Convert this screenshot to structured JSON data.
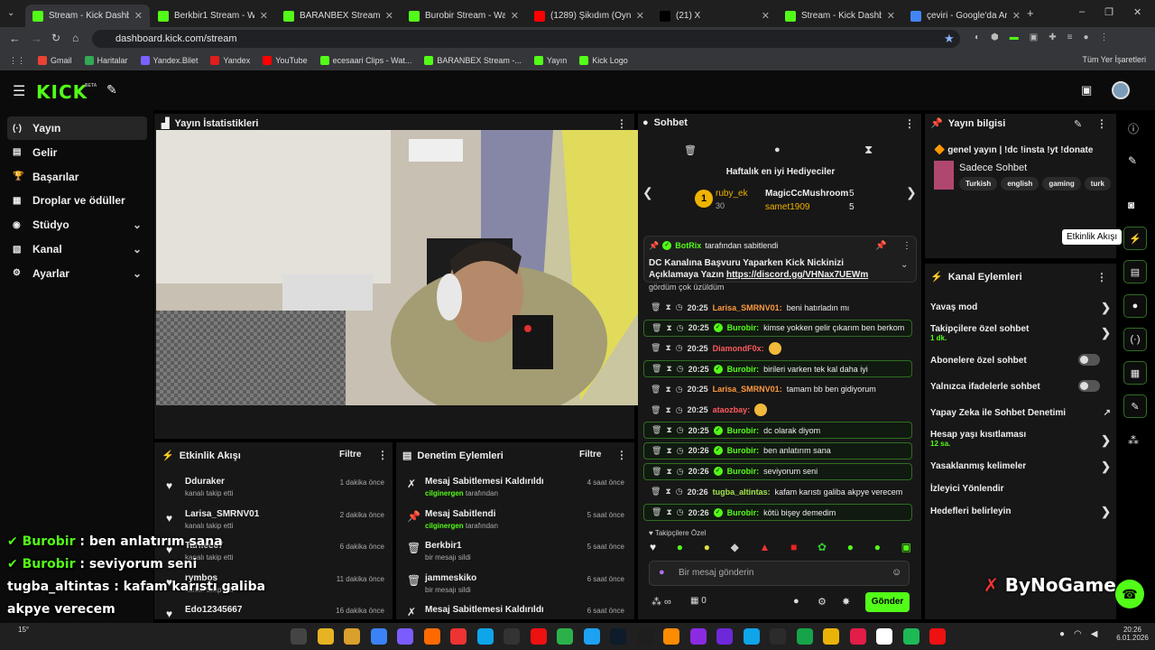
{
  "browser": {
    "tabs": [
      {
        "title": "Stream - Kick Dashboard",
        "active": true,
        "color": "#53fc18"
      },
      {
        "title": "Berkbir1 Stream - Watch L",
        "color": "#53fc18"
      },
      {
        "title": "BARANBEX Stream - Watc",
        "color": "#53fc18"
      },
      {
        "title": "Burobir Stream - Watch Li",
        "color": "#53fc18"
      },
      {
        "title": "(1289) Şikıdım (Oynan",
        "color": "#ff0000"
      },
      {
        "title": "(21) X",
        "color": "#000000"
      },
      {
        "title": "Stream - Kick Dashboard",
        "color": "#53fc18"
      },
      {
        "title": "çeviri - Google'da Ara",
        "color": "#4285f4"
      }
    ],
    "url": "dashboard.kick.com/stream",
    "bookmarks": [
      "Gmail",
      "Haritalar",
      "Yandex.Bilet",
      "Yandex",
      "YouTube",
      "ecesaari Clips - Wat...",
      "BARANBEX Stream -...",
      "Yayın",
      "Kick Logo"
    ],
    "bookmarks_right": "Tüm Yer İşaretleri"
  },
  "app": {
    "logo": "KICK",
    "beta": "BETA",
    "accent": "#53fc18"
  },
  "sidebar": {
    "items": [
      {
        "icon": "(·)",
        "label": "Yayın"
      },
      {
        "icon": "▤",
        "label": "Gelir"
      },
      {
        "icon": "🏆",
        "label": "Başarılar"
      },
      {
        "icon": "▦",
        "label": "Droplar ve ödüller"
      },
      {
        "icon": "◉",
        "label": "Stüdyo"
      },
      {
        "icon": "▧",
        "label": "Kanal"
      },
      {
        "icon": "⚙",
        "label": "Ayarlar"
      }
    ]
  },
  "stats_panel": {
    "title": "Yayın İstatistikleri"
  },
  "chat": {
    "title": "Sohbet",
    "gifters_title": "Haftalık en iyi Hediyeciler",
    "gifters": [
      {
        "rank": "1",
        "name": "ruby_ek",
        "count": "30"
      },
      {
        "name": "MagicCcMushroom",
        "count": "5"
      },
      {
        "name": "samet1909",
        "count": "5"
      }
    ],
    "pinned_by_user": "BotRix",
    "pinned_by_suffix": "tarafından sabitlendi",
    "pinned_text": "DC Kanalına Başvuru Yaparken Kick Nickinizi Açıklamaya Yazın",
    "pinned_link": "https://discord.gg/VHNax7UEWm",
    "partial_line": "gördüm çok üzüldüm",
    "messages": [
      {
        "time": "20:25",
        "user": "Larisa_SMRNV01",
        "color": "#ff9a3d",
        "text": "beni hatırladın mı",
        "hl": false
      },
      {
        "time": "20:25",
        "user": "Burobir",
        "color": "#53fc18",
        "text": "kimse yokken gelir çıkarım ben berkom",
        "hl": true
      },
      {
        "time": "20:25",
        "user": "DiamondF0x",
        "color": "#ff5b5b",
        "text": "",
        "hl": false
      },
      {
        "time": "20:25",
        "user": "Burobir",
        "color": "#53fc18",
        "text": "birileri varken tek kal daha iyi",
        "hl": true
      },
      {
        "time": "20:25",
        "user": "Larisa_SMRNV01",
        "color": "#ff9a3d",
        "text": "tamam bb ben gidiyorum",
        "hl": false
      },
      {
        "time": "20:25",
        "user": "ataozbay",
        "color": "#ff5b5b",
        "text": "",
        "hl": false
      },
      {
        "time": "20:25",
        "user": "Burobir",
        "color": "#53fc18",
        "text": "dc olarak diyom",
        "hl": true
      },
      {
        "time": "20:26",
        "user": "Burobir",
        "color": "#53fc18",
        "text": "ben anlatırım sana",
        "hl": true
      },
      {
        "time": "20:26",
        "user": "Burobir",
        "color": "#53fc18",
        "text": "seviyorum seni",
        "hl": true
      },
      {
        "time": "20:26",
        "user": "tugba_altintas",
        "color": "#a0e34a",
        "text": "kafam karıstı galiba akpye verecem",
        "hl": false
      },
      {
        "time": "20:26",
        "user": "Burobir",
        "color": "#53fc18",
        "text": "kötü bişey demedim",
        "hl": true
      }
    ],
    "followers_only": "Takipçilere Özel",
    "input_placeholder": "Bir mesaj gönderin",
    "points": "0",
    "send_label": "Gönder"
  },
  "events": {
    "title": "Etkinlik Akışı",
    "filter": "Filtre",
    "items": [
      {
        "name": "Dduraker",
        "sub": "kanalı takip etti",
        "time": "1 dakika önce"
      },
      {
        "name": "Larisa_SMRNV01",
        "sub": "kanalı takip etti",
        "time": "2 dakika önce"
      },
      {
        "name": "Tarllec67",
        "sub": "kanalı takip etti",
        "time": "6 dakika önce"
      },
      {
        "name": "rymbos",
        "sub": "kanalı takip etti",
        "time": "11 dakika önce"
      },
      {
        "name": "Edo12345667",
        "sub": "",
        "time": "16 dakika önce"
      }
    ]
  },
  "mod": {
    "title": "Denetim Eylemleri",
    "filter": "Filtre",
    "items": [
      {
        "icon": "✗",
        "name": "Mesaj Sabitlemesi Kaldırıldı",
        "user": "cilginergen",
        "sub": "tarafından",
        "time": "4 saat önce"
      },
      {
        "icon": "📌",
        "name": "Mesaj Sabitlendi",
        "user": "cilginergen",
        "sub": "tarafından",
        "time": "5 saat önce"
      },
      {
        "icon": "🗑",
        "name": "Berkbir1",
        "user": "",
        "sub": "bir mesajı sildi",
        "time": "5 saat önce"
      },
      {
        "icon": "🗑",
        "name": "jammeskiko",
        "user": "",
        "sub": "bir mesajı sildi",
        "time": "6 saat önce"
      },
      {
        "icon": "✗",
        "name": "Mesaj Sabitlemesi Kaldırıldı",
        "user": "",
        "sub": "",
        "time": "6 saat önce"
      }
    ]
  },
  "stream_info": {
    "title": "Yayın bilgisi",
    "stream_title": "genel yayın | !dc !insta !yt !donate",
    "category": "Sadece Sohbet",
    "tags": [
      "Turkish",
      "english",
      "gaming",
      "turk"
    ]
  },
  "channel_actions": {
    "title": "Kanal Eylemleri",
    "slow_mode": "Yavaş mod",
    "followers_chat": "Takipçilere özel sohbet",
    "followers_chat_value": "1 dk.",
    "subs_chat": "Abonelere özel sohbet",
    "emotes_chat": "Yalnızca ifadelerle sohbet",
    "ai_mod": "Yapay Zeka ile Sohbet Denetimi",
    "age_limit": "Hesap yaşı kısıtlaması",
    "age_limit_value": "12 sa.",
    "banned_words": "Yasaklanmış kelimeler",
    "raid": "İzleyici Yönlendir",
    "goals": "Hedefleri belirleyin"
  },
  "tooltip": "Etkinlik Akışı",
  "overlay": {
    "lines": [
      {
        "user": "Burobir",
        "text": ": ben anlatırım sana"
      },
      {
        "user": "Burobir",
        "text": ": seviyorum seni"
      },
      {
        "user": "tugba_altintas",
        "text": ": kafam karıstı galiba"
      },
      {
        "user": "",
        "text": "akpye verecem"
      },
      {
        "user": "Burobir",
        "text": ": kötü bişey demedim"
      }
    ],
    "watermark": "ByNoGame"
  },
  "taskbar": {
    "weather": "15°",
    "time": "20:26",
    "date": "6.01.2026"
  }
}
